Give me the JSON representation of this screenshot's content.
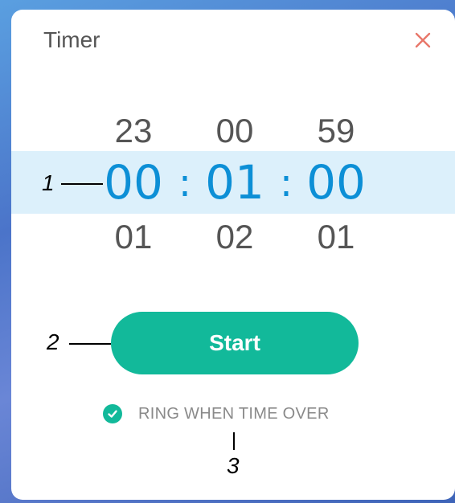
{
  "dialog": {
    "title": "Timer",
    "close_icon": "close-icon",
    "close_color": "#e8776a"
  },
  "picker": {
    "hours": {
      "prev": "23",
      "current": "00",
      "next": "01"
    },
    "minutes": {
      "prev": "00",
      "current": "01",
      "next": "02"
    },
    "seconds": {
      "prev": "59",
      "current": "00",
      "next": "01"
    },
    "separator": ":",
    "accent_color": "#0c8fd6",
    "highlight_color": "#dcf0fb"
  },
  "start_button": {
    "label": "Start",
    "color": "#12b99a"
  },
  "ring_option": {
    "label": "RING WHEN TIME OVER",
    "checked": true,
    "check_icon": "check-circle-icon"
  },
  "callouts": {
    "one": "1",
    "two": "2",
    "three": "3"
  }
}
